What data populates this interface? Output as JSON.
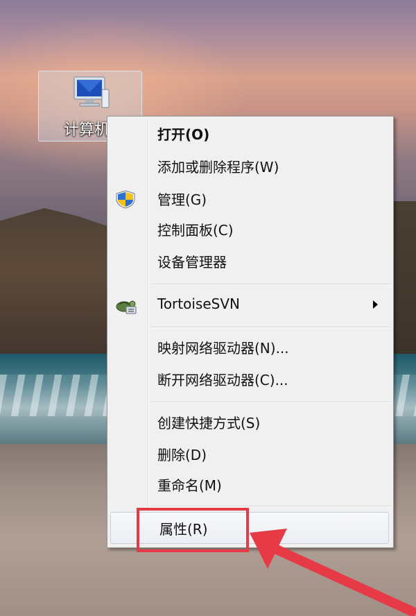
{
  "desktop": {
    "icon_label": "计算机"
  },
  "context_menu": {
    "items": [
      {
        "id": "open",
        "label": "打开(O)",
        "bold": true
      },
      {
        "id": "add_remove_programs",
        "label": "添加或删除程序(W)"
      },
      {
        "id": "manage",
        "label": "管理(G)",
        "icon": "uac-shield-icon"
      },
      {
        "id": "control_panel",
        "label": "控制面板(C)"
      },
      {
        "id": "device_manager",
        "label": "设备管理器"
      },
      {
        "id": "tortoisesvn",
        "label": "TortoiseSVN",
        "icon": "tortoisesvn-icon",
        "submenu": true
      },
      {
        "id": "map_network_drive",
        "label": "映射网络驱动器(N)..."
      },
      {
        "id": "disconnect_network_drive",
        "label": "断开网络驱动器(C)..."
      },
      {
        "id": "create_shortcut",
        "label": "创建快捷方式(S)"
      },
      {
        "id": "delete",
        "label": "删除(D)"
      },
      {
        "id": "rename",
        "label": "重命名(M)"
      },
      {
        "id": "properties",
        "label": "属性(R)",
        "highlighted": true
      }
    ]
  },
  "annotation": {
    "color": "#e63b46",
    "target": "properties"
  }
}
